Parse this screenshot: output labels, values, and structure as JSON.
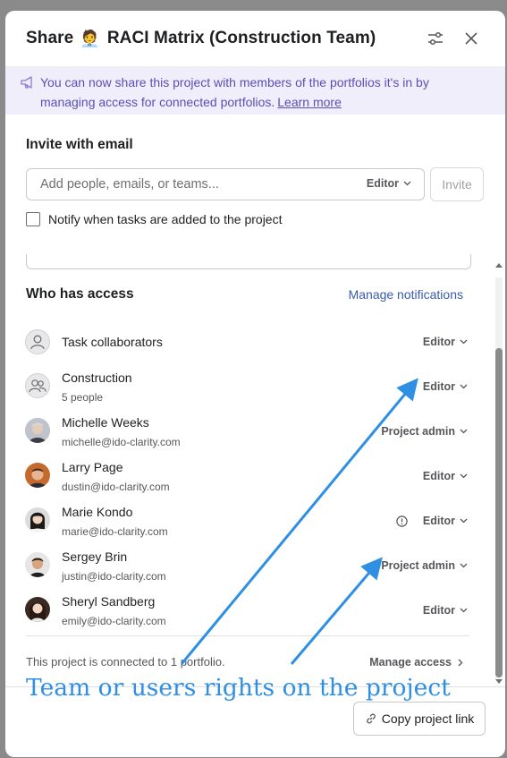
{
  "header": {
    "title_prefix": "Share",
    "title_emoji": "🧑‍💼",
    "title_project": "RACI Matrix (Construction Team)",
    "icons": [
      "settings-sliders-icon",
      "close-icon"
    ]
  },
  "banner": {
    "text": "You can now share this project with members of the portfolios it's in by managing access for connected portfolios.",
    "link": "Learn more",
    "icon": "megaphone-icon"
  },
  "invite": {
    "heading": "Invite with email",
    "placeholder": "Add people, emails, or teams...",
    "role": "Editor",
    "button": "Invite",
    "notify_label": "Notify when tasks are added to the project",
    "notify_checked": false
  },
  "access": {
    "heading": "Who has access",
    "manage_notifications": "Manage notifications",
    "members": [
      {
        "name": "Task collaborators",
        "sub": "",
        "role": "Editor",
        "avatar": "person-icon"
      },
      {
        "name": "Construction",
        "sub": "5 people",
        "role": "Editor",
        "avatar": "team-icon"
      },
      {
        "name": "Michelle Weeks",
        "sub": "michelle@ido-clarity.com",
        "role": "Project admin",
        "avatar": "photo"
      },
      {
        "name": "Larry Page",
        "sub": "dustin@ido-clarity.com",
        "role": "Editor",
        "avatar": "photo"
      },
      {
        "name": "Marie Kondo",
        "sub": "marie@ido-clarity.com",
        "role": "Editor",
        "avatar": "photo",
        "alert": true
      },
      {
        "name": "Sergey Brin",
        "sub": "justin@ido-clarity.com",
        "role": "Project admin",
        "avatar": "photo"
      },
      {
        "name": "Sheryl Sandberg",
        "sub": "emily@ido-clarity.com",
        "role": "Editor",
        "avatar": "photo"
      }
    ],
    "connected_text": "This project is connected to 1 portfolio.",
    "manage_access": "Manage access"
  },
  "footer": {
    "copy_link": "Copy project link"
  },
  "annotation": {
    "text": "Team or users rights on the project",
    "color": "#2f8fe3"
  },
  "colors": {
    "banner_bg": "#f0eefb",
    "banner_text": "#5b4fb4",
    "link": "#3b5ba9"
  }
}
